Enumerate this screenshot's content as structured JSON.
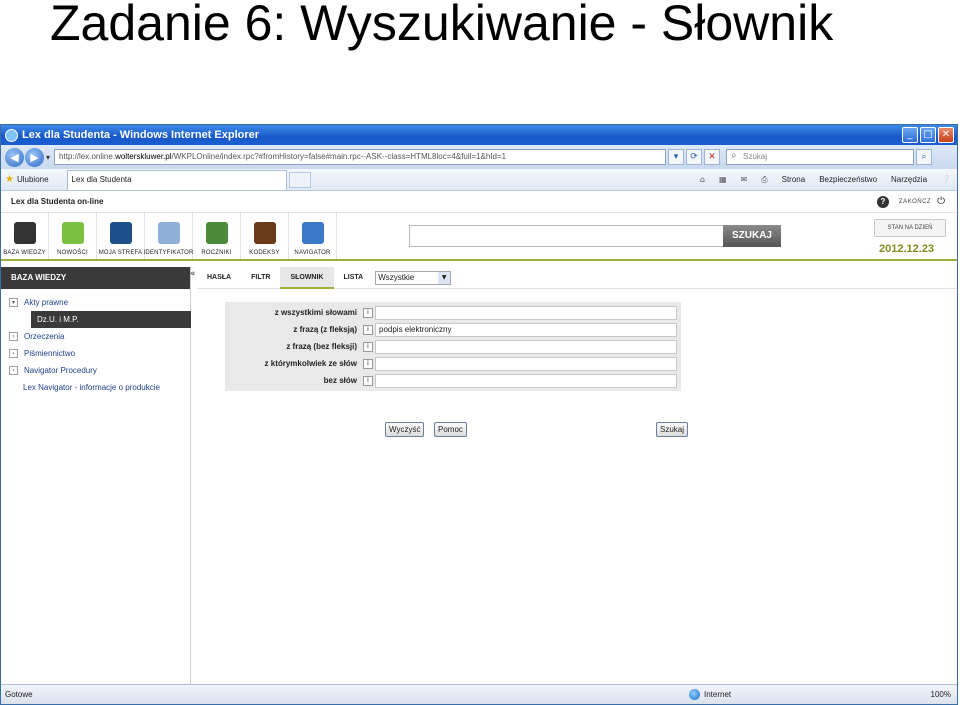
{
  "slide": {
    "title": "Zadanie 6: Wyszukiwanie - Słownik"
  },
  "browser": {
    "window_title": "Lex dla Studenta - Windows Internet Explorer",
    "address_prefix": "http://lex.online.",
    "address_domain": "wolterskluwer.pl",
    "address_rest": "/WKPLOnline/index.rpc?#fromHistory=false#main.rpc--ASK--class=HTML8loc=4&full=1&hId=1",
    "search_placeholder": "Szukaj",
    "favorites_label": "Ulubione",
    "tab_label": "Lex dla Studenta",
    "menu_page": "Strona",
    "menu_security": "Bezpieczeństwo",
    "menu_tools": "Narzędzia",
    "status_text": "Gotowe",
    "zone_text": "Internet",
    "zoom_text": "100%"
  },
  "lex": {
    "site_title": "Lex dla Studenta on-line",
    "logout_label": "ZAKOŃCZ",
    "modules": [
      {
        "label": "BAZA WIEDZY",
        "icon": "knowledge-base-icon",
        "color": "#333333"
      },
      {
        "label": "NOWOŚCI",
        "icon": "news-icon",
        "color": "#7cc242"
      },
      {
        "label": "MOJA STREFA",
        "icon": "my-zone-icon",
        "color": "#1f4f8a"
      },
      {
        "label": "IDENTYFIKATOR",
        "icon": "identifier-icon",
        "color": "#8fb0d8"
      },
      {
        "label": "ROCZNIKI",
        "icon": "yearbooks-icon",
        "color": "#4a8a3a"
      },
      {
        "label": "KODEKSY",
        "icon": "codes-icon",
        "color": "#6b3a1a"
      },
      {
        "label": "NAVIGATOR",
        "icon": "navigator-icon",
        "color": "#3a7ac8"
      }
    ],
    "search_button": "SZUKAJ",
    "state_button": "STAN NA DZIEŃ",
    "state_date": "2012.12.23",
    "sidebar_title": "BAZA WIEDZY",
    "sidebar_items": [
      {
        "label": "Akty prawne",
        "toggle": "v"
      },
      {
        "label": "Dz.U. i M.P.",
        "toggle": ""
      },
      {
        "label": "Orzeczenia",
        "toggle": ">"
      },
      {
        "label": "Piśmiennictwo",
        "toggle": ">"
      },
      {
        "label": "Navigator Procedury",
        "toggle": ">"
      },
      {
        "label": "Lex Navigator - informacje o produkcie",
        "toggle": ""
      }
    ],
    "subtabs": [
      "HASŁA",
      "FILTR",
      "SŁOWNIK",
      "LISTA"
    ],
    "subtab_select_value": "Wszystkie",
    "form_rows": [
      {
        "label": "z wszystkimi słowami",
        "value": ""
      },
      {
        "label": "z frazą (z fleksją)",
        "value": "podpis elektroniczny"
      },
      {
        "label": "z frazą (bez fleksji)",
        "value": ""
      },
      {
        "label": "z którymkolwiek ze słów",
        "value": ""
      },
      {
        "label": "bez słów",
        "value": ""
      }
    ],
    "help_glyph": "i",
    "buttons": {
      "clear": "Wyczyść",
      "help": "Pomoc",
      "search": "Szukaj"
    }
  }
}
